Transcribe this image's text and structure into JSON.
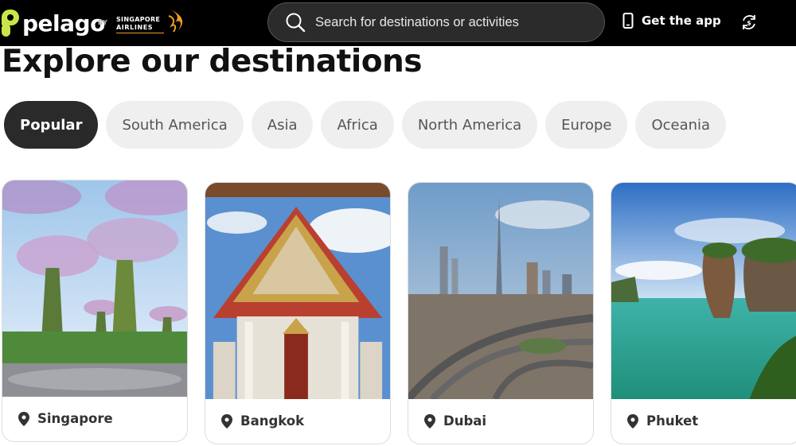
{
  "header": {
    "logo_text": "pelago",
    "by_text": "BY",
    "airline_line1": "SINGAPORE",
    "airline_line2": "AIRLINES",
    "search_placeholder": "Search for destinations or activities",
    "get_app_label": "Get the app"
  },
  "page": {
    "title": "Explore our destinations"
  },
  "tabs": [
    {
      "label": "Popular",
      "active": true
    },
    {
      "label": "South America",
      "active": false
    },
    {
      "label": "Asia",
      "active": false
    },
    {
      "label": "Africa",
      "active": false
    },
    {
      "label": "North America",
      "active": false
    },
    {
      "label": "Europe",
      "active": false
    },
    {
      "label": "Oceania",
      "active": false
    }
  ],
  "destinations": [
    {
      "name": "Singapore"
    },
    {
      "name": "Bangkok"
    },
    {
      "name": "Dubai"
    },
    {
      "name": "Phuket"
    }
  ],
  "colors": {
    "brand_lime": "#c8e64a",
    "header_bg": "#000000",
    "tab_active_bg": "#2a2a2a",
    "tab_bg": "#efefef"
  },
  "icons": {
    "search": "search-icon",
    "phone": "phone-icon",
    "currency": "currency-exchange-icon",
    "location": "location-pin-icon"
  }
}
